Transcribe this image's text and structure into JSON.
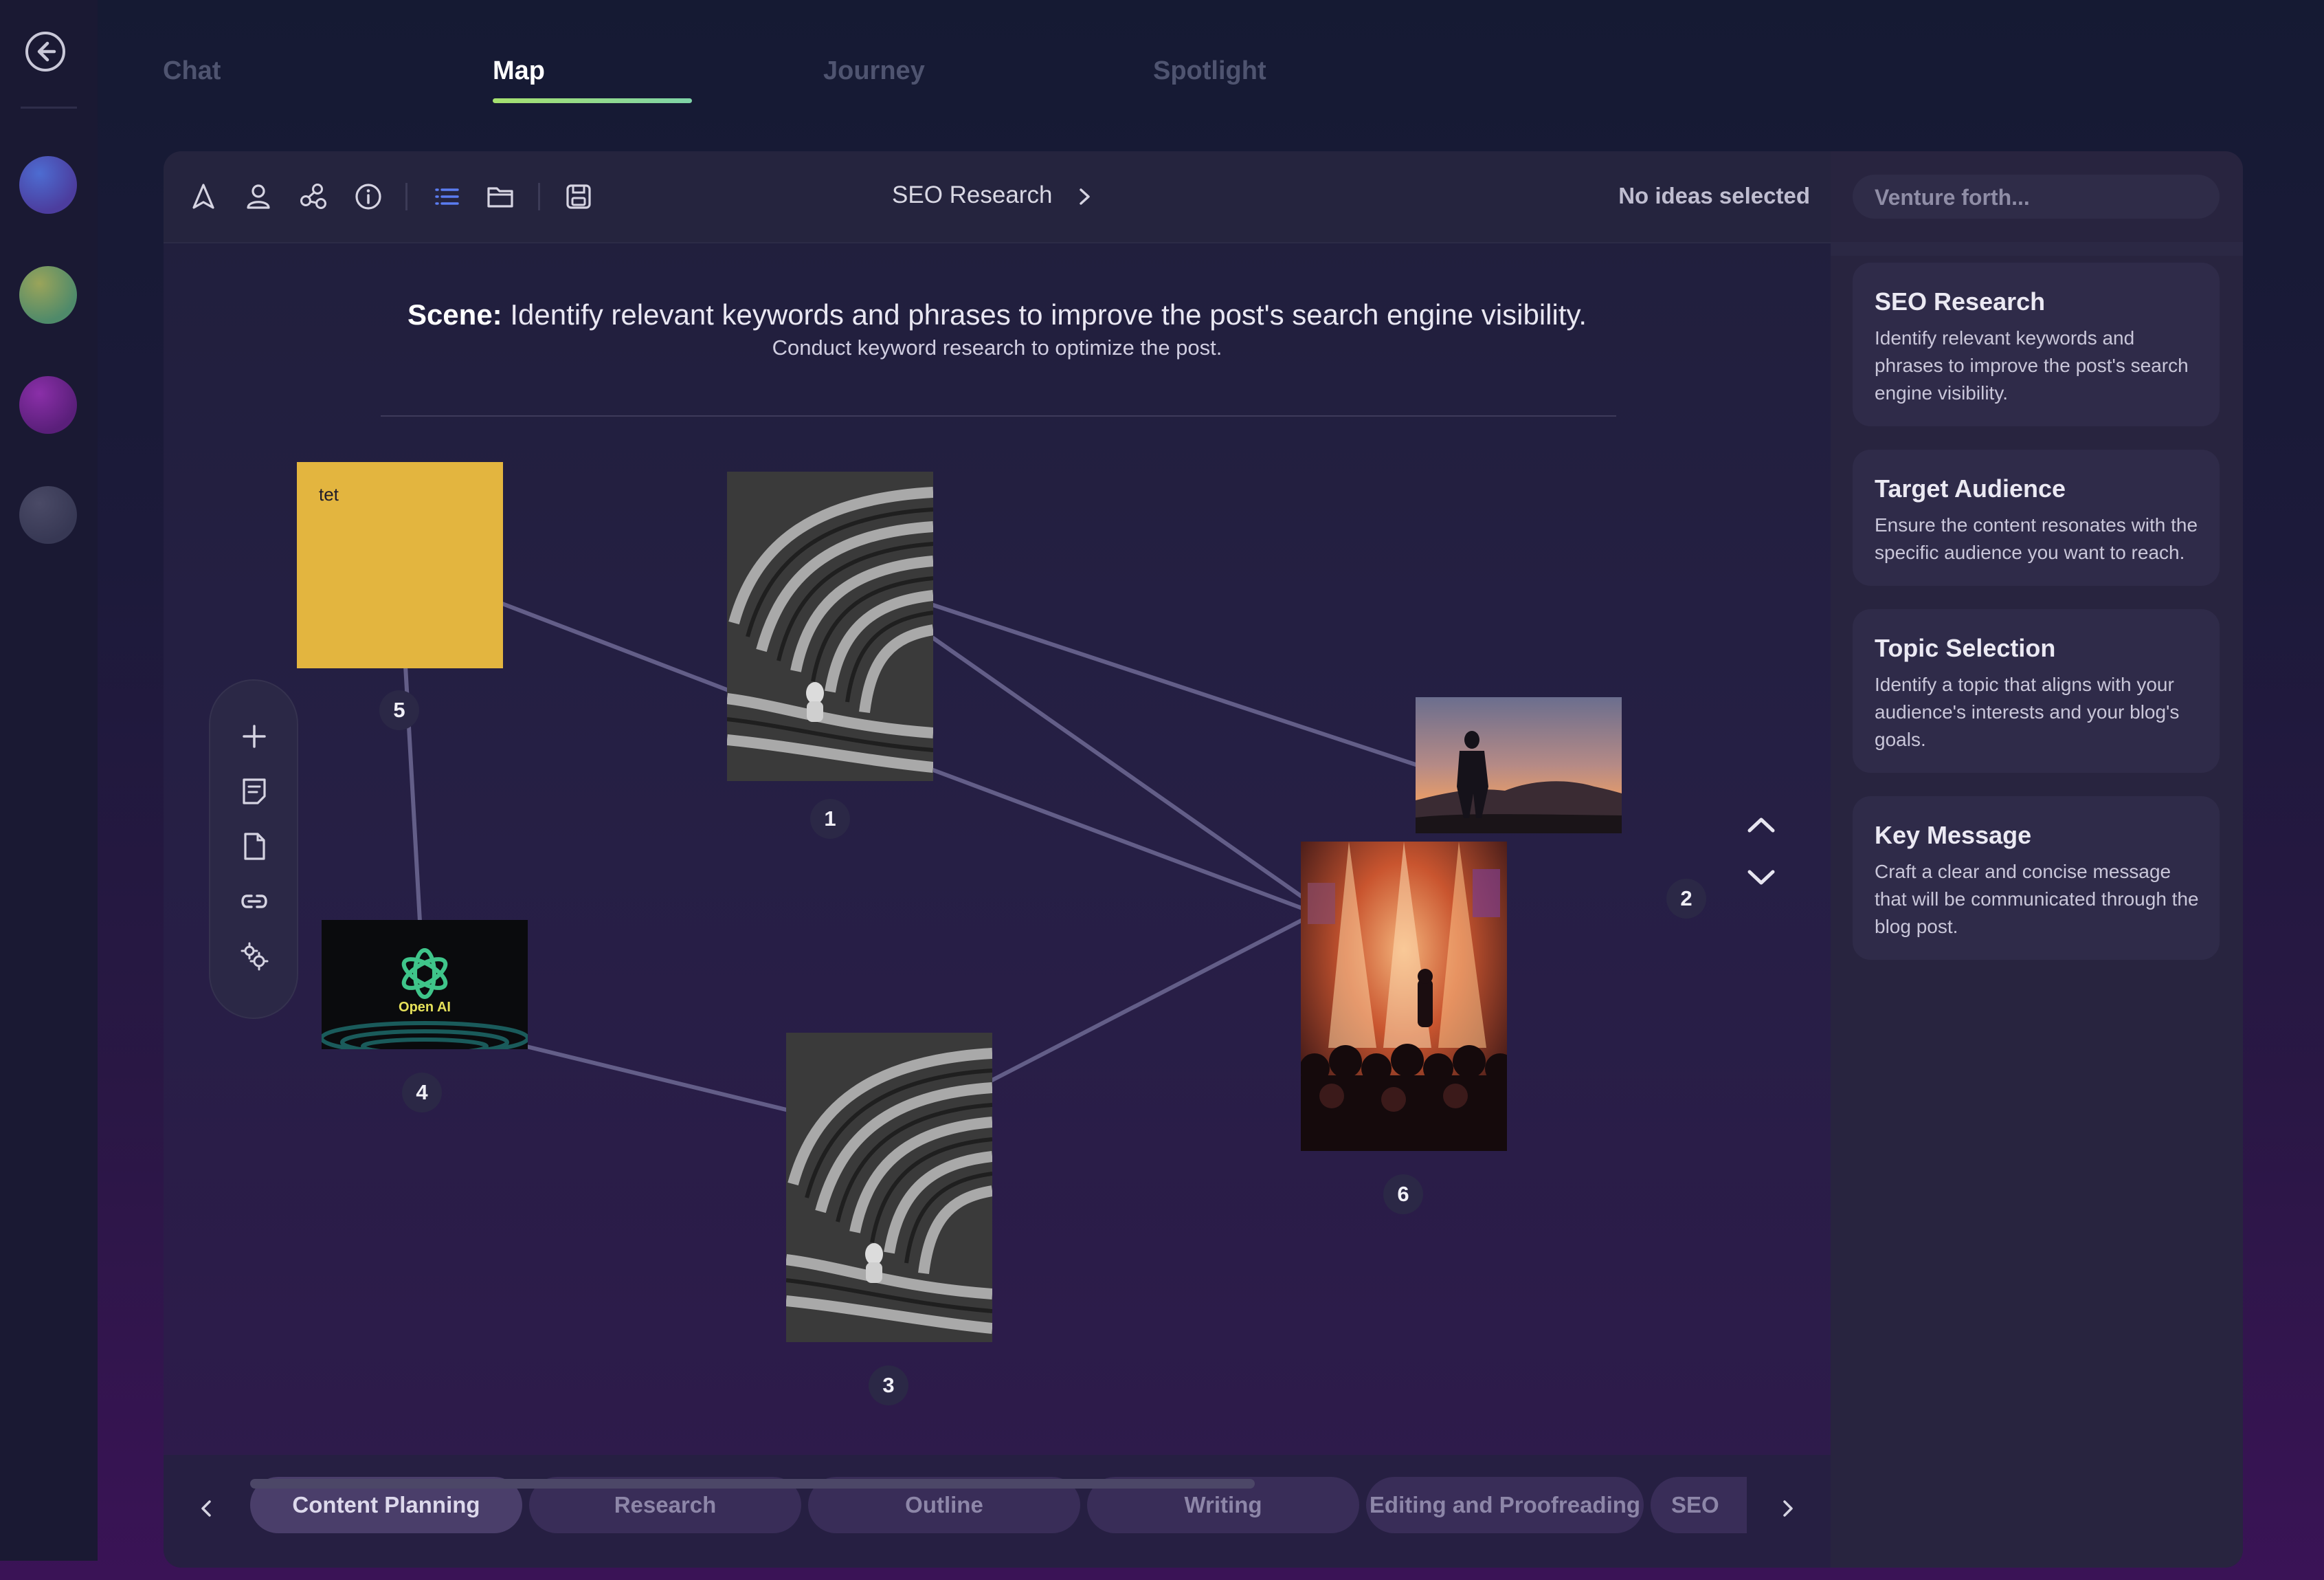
{
  "tabs": [
    "Chat",
    "Map",
    "Journey",
    "Spotlight"
  ],
  "active_tab": "Map",
  "toolbar": {
    "icons": [
      "navigate-icon",
      "user-icon",
      "share-nodes-icon",
      "info-icon",
      "list-icon",
      "folder-icon",
      "save-icon"
    ],
    "breadcrumb": "SEO Research",
    "selection_status": "No ideas selected"
  },
  "search": {
    "placeholder": "Venture forth..."
  },
  "scene": {
    "label": "Scene:",
    "text": " Identify relevant keywords and phrases to improve the post's search engine visibility.",
    "subtitle": "Conduct keyword research to optimize the post."
  },
  "nodes": [
    {
      "id": "1",
      "kind": "image",
      "image": "maze-person-icon"
    },
    {
      "id": "2",
      "kind": "image",
      "image": "sunset-silhouette-icon"
    },
    {
      "id": "3",
      "kind": "image",
      "image": "maze-person-icon"
    },
    {
      "id": "4",
      "kind": "image",
      "image": "openai-logo-icon",
      "caption": "Open AI"
    },
    {
      "id": "5",
      "kind": "sticky-note",
      "text": "tet"
    },
    {
      "id": "6",
      "kind": "image",
      "image": "concert-crowd-icon"
    }
  ],
  "canvas_tools": [
    "add-icon",
    "note-icon",
    "document-icon",
    "link-icon",
    "settings-icon"
  ],
  "sidebar": {
    "cards": [
      {
        "title": "SEO Research",
        "desc": "Identify relevant keywords and phrases to improve the post's search engine visibility."
      },
      {
        "title": "Target Audience",
        "desc": "Ensure the content resonates with the specific audience you want to reach."
      },
      {
        "title": "Topic Selection",
        "desc": "Identify a topic that aligns with your audience's interests and your blog's goals."
      },
      {
        "title": "Key Message",
        "desc": "Craft a clear and concise message that will be communicated through the blog post."
      }
    ]
  },
  "stages": [
    "Content Planning",
    "Research",
    "Outline",
    "Writing",
    "Editing and Proofreading",
    "SEO"
  ],
  "active_stage": "Content Planning",
  "colors": {
    "accent": "#a6e06f",
    "sticky": "#e3b53f",
    "link": "#6a6590"
  }
}
